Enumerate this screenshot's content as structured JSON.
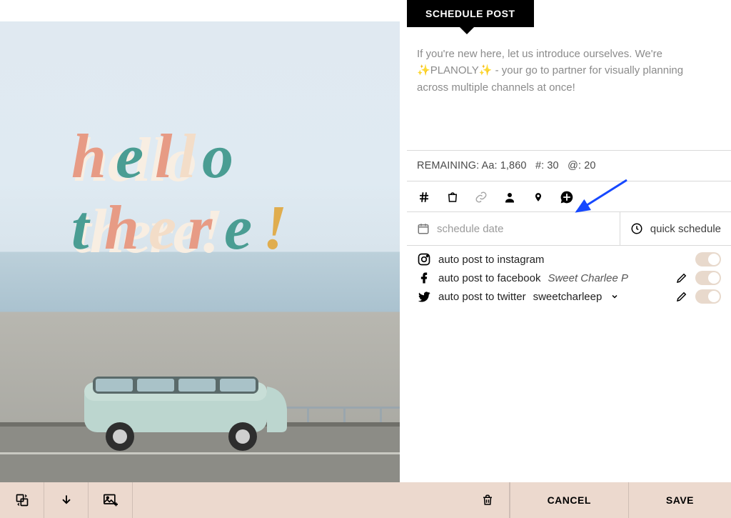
{
  "tab": {
    "label": "SCHEDULE POST"
  },
  "caption": {
    "line1": "If you're new here, let us introduce ourselves. We're",
    "brand": "PLANOLY",
    "line2": " - your go to partner for visually planning across multiple channels at once!"
  },
  "remaining": {
    "prefix": "REMAINING:",
    "aa_label": "Aa:",
    "aa_value": "1,860",
    "hash_label": "#:",
    "hash_value": "30",
    "at_label": "@:",
    "at_value": "20"
  },
  "toolbar_icons": [
    "hashtag",
    "shopping-bag",
    "link",
    "tag-person",
    "location-pin",
    "add-comment"
  ],
  "schedule": {
    "placeholder": "schedule date",
    "quick_label": "quick schedule"
  },
  "autopost": [
    {
      "network": "instagram",
      "label": "auto post to instagram",
      "handle": "",
      "editable": false
    },
    {
      "network": "facebook",
      "label": "auto post to facebook",
      "handle": "Sweet Charlee P",
      "editable": true
    },
    {
      "network": "twitter",
      "label": "auto post to twitter",
      "handle": "sweetcharleep",
      "editable": true,
      "caret": true
    }
  ],
  "bottom": {
    "cancel": "CANCEL",
    "save": "SAVE"
  },
  "preview_text": {
    "word1": "hello",
    "word2": "there",
    "bang": "!"
  },
  "colors": {
    "coral": "#e79b85",
    "teal": "#4a9d93",
    "cream": "#f3ddc8",
    "mustard": "#e0ad4e"
  }
}
